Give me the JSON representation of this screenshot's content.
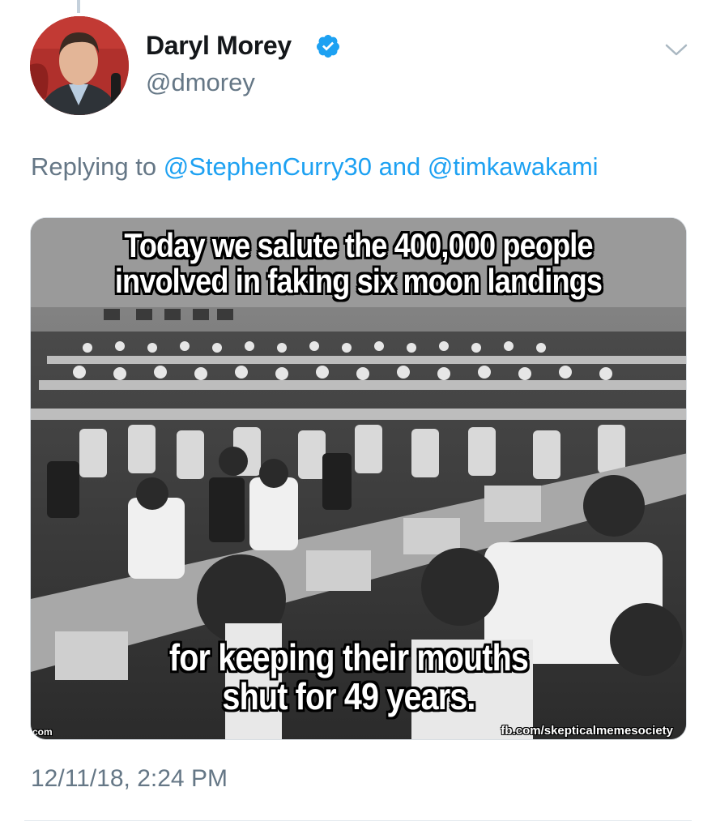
{
  "tweet": {
    "author": {
      "display_name": "Daryl Morey",
      "handle": "@dmorey",
      "verified": true
    },
    "replying": {
      "prefix": "Replying to",
      "mention_1": "@StephenCurry30",
      "joiner": "and",
      "mention_2": "@timkawakami"
    },
    "media": {
      "caption_top_line1": "Today we salute the 400,000 people",
      "caption_top_line2": "involved in faking six moon landings",
      "caption_bottom_line1": "for keeping their mouths",
      "caption_bottom_line2": "shut for 49 years.",
      "watermark_right": "fb.com/skepticalmemesociety",
      "watermark_left": "com"
    },
    "timestamp": "12/11/18, 2:24 PM"
  },
  "icons": {
    "verified": "verified-badge-icon",
    "more": "chevron-down-icon"
  },
  "colors": {
    "link": "#1da1f2",
    "secondary_text": "#657786",
    "primary_text": "#14171a",
    "verified": "#1da1f2"
  }
}
